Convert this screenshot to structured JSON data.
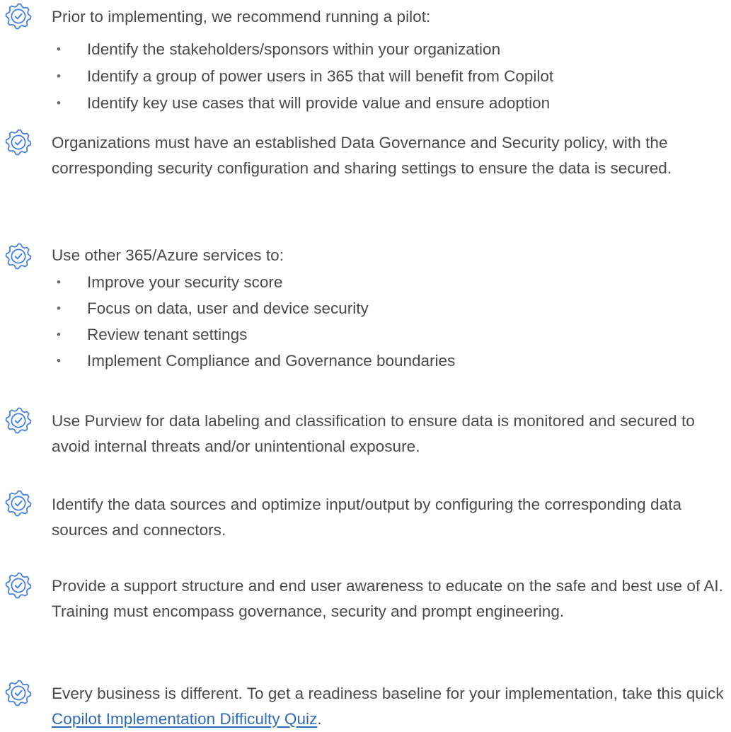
{
  "icon_color": "#3b7ce5",
  "icon_name": "gear-check-icon",
  "items": [
    {
      "text": "Prior to implementing, we recommend running a pilot:",
      "bullets": [
        "Identify the stakeholders/sponsors within your organization",
        "Identify a group of power users in 365 that will benefit from Copilot",
        "Identify key use cases that will provide value and ensure adoption"
      ]
    },
    {
      "text": "Organizations must have an established Data Governance and Security policy, with the corresponding security configuration and sharing settings to ensure the data is secured."
    },
    {
      "text": "Use other 365/Azure services to:",
      "bullets": [
        "Improve your security score",
        "Focus on data, user and device security",
        "Review tenant settings",
        "Implement Compliance and Governance boundaries"
      ]
    },
    {
      "text": "Use Purview for data labeling and classification to ensure data is monitored and secured to avoid internal threats and/or unintentional exposure."
    },
    {
      "text": "Identify the data sources and optimize input/output by configuring the corresponding data sources and connectors."
    },
    {
      "text": "Provide a support structure and end user awareness to educate on the safe and best use of AI. Training must encompass governance, security and prompt engineering."
    },
    {
      "text_before_link": "Every business is different. To get a readiness baseline for your implementation, take this quick ",
      "link_text": "Copilot Implementation Difficulty Quiz",
      "text_after_link": "."
    }
  ],
  "bullet_glyph": "•",
  "link_color": "#2f6ab8"
}
